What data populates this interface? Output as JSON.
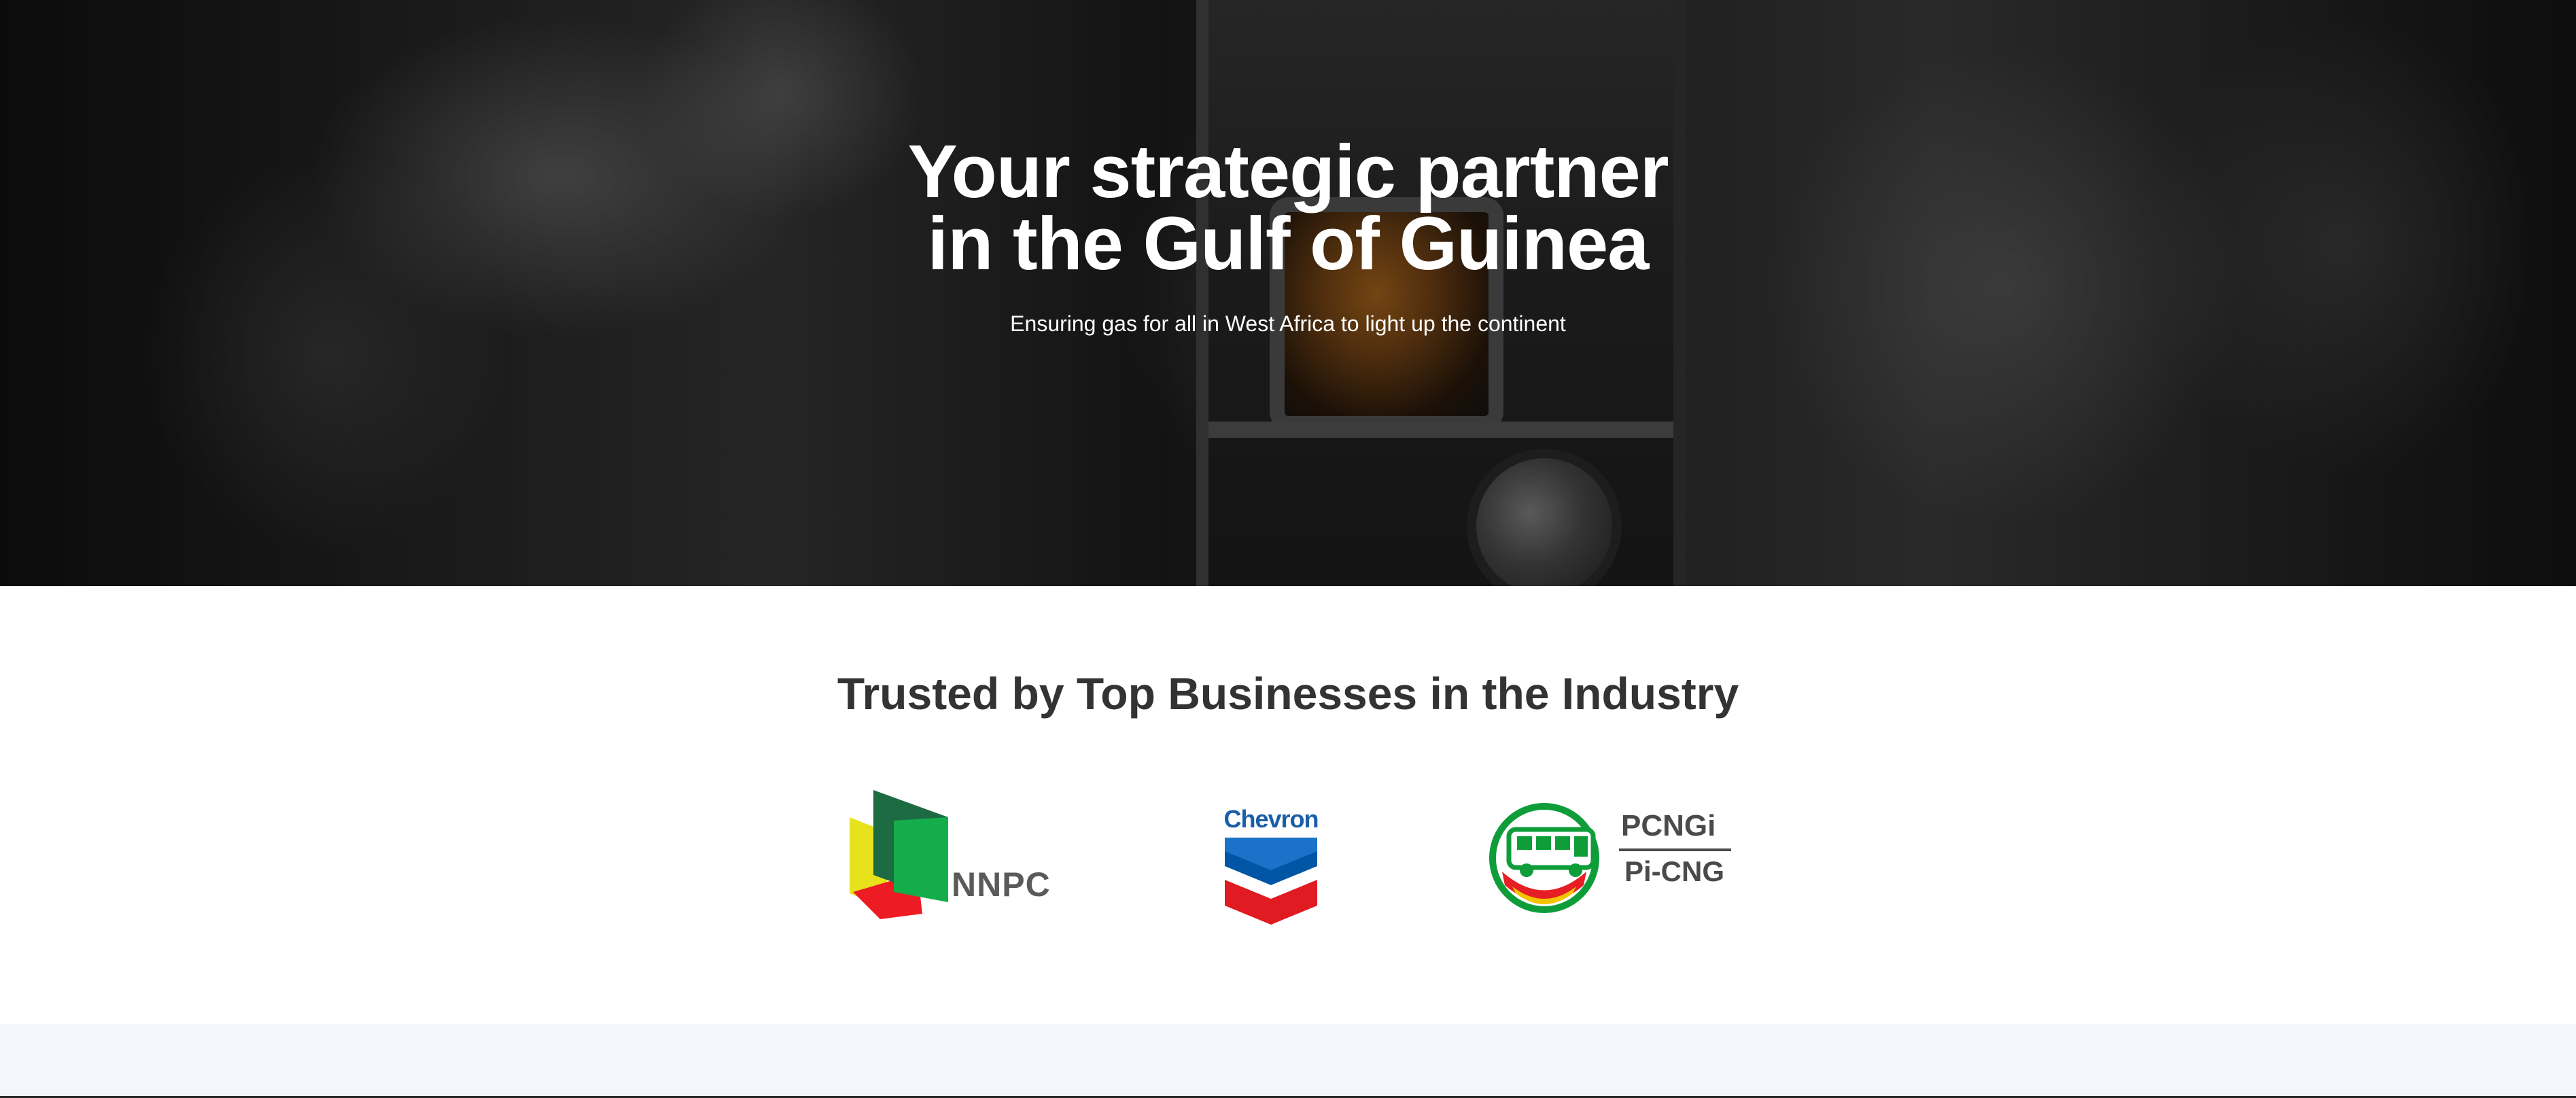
{
  "hero": {
    "title_line1": "Your strategic partner",
    "title_line2": "in the Gulf of Guinea",
    "subtitle": "Ensuring gas for all in West Africa to light up the continent"
  },
  "trusted": {
    "title": "Trusted by Top Businesses in the Industry",
    "logos": [
      {
        "name": "NNPC",
        "text": "NNPC",
        "icon": "nnpc-logo-icon",
        "colors": [
          "#e8e21c",
          "#ed1c24",
          "#1d6b43",
          "#13ad4b"
        ]
      },
      {
        "name": "Chevron",
        "text": "Chevron",
        "icon": "chevron-logo-icon",
        "colors": [
          "#0055a4",
          "#e11b22"
        ]
      },
      {
        "name": "PCNGi",
        "text_top": "PCNGi",
        "text_bottom": "Pi-CNG",
        "icon": "pcngi-bus-logo-icon",
        "colors": [
          "#0f9d3a",
          "#e61e25",
          "#f5c400"
        ]
      }
    ]
  },
  "colors": {
    "heading": "#333333",
    "hero_text": "#ffffff",
    "bottom_band": "#f5f5fc"
  }
}
